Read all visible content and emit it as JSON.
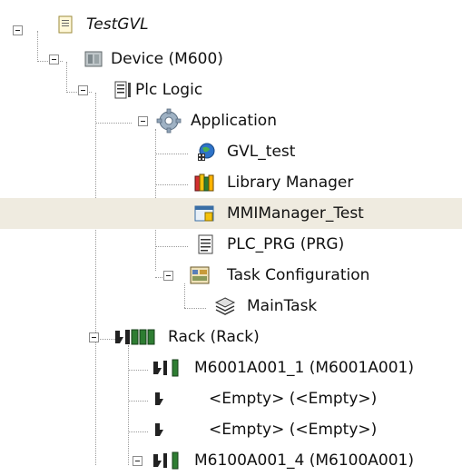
{
  "tree": {
    "nodes": [
      {
        "name": "testgvl",
        "label": "TestGVL",
        "icon": "project-file-icon",
        "italic": true,
        "expanded": true
      },
      {
        "name": "device",
        "label": "Device (M600)",
        "icon": "device-icon",
        "expanded": true
      },
      {
        "name": "plc-logic",
        "label": "Plc Logic",
        "icon": "plc-logic-icon",
        "expanded": true
      },
      {
        "name": "application",
        "label": "Application",
        "icon": "application-gear-icon",
        "expanded": true
      },
      {
        "name": "gvl-test",
        "label": "GVL_test",
        "icon": "globe-icon"
      },
      {
        "name": "library-manager",
        "label": "Library Manager",
        "icon": "books-icon"
      },
      {
        "name": "mmimanager-test",
        "label": "MMIManager_Test",
        "icon": "window-icon",
        "selected": true
      },
      {
        "name": "plc-prg",
        "label": "PLC_PRG (PRG)",
        "icon": "document-icon"
      },
      {
        "name": "task-configuration",
        "label": "Task Configuration",
        "icon": "task-config-icon",
        "expanded": true
      },
      {
        "name": "main-task",
        "label": "MainTask",
        "icon": "task-stack-icon"
      },
      {
        "name": "rack",
        "label": "Rack (Rack)",
        "icon": "rack-icon",
        "expanded": true
      },
      {
        "name": "m6001a001-1",
        "label": "M6001A001_1 (M6001A001)",
        "icon": "io-module-icon"
      },
      {
        "name": "empty-1",
        "label": "<Empty> (<Empty>)",
        "icon": "empty-slot-icon"
      },
      {
        "name": "empty-2",
        "label": "<Empty> (<Empty>)",
        "icon": "empty-slot-icon"
      },
      {
        "name": "m6100a001-4",
        "label": "M6100A001_4 (M6100A001)",
        "icon": "io-module-icon",
        "expanded": true
      }
    ]
  }
}
